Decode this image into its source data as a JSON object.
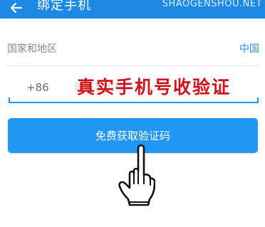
{
  "header": {
    "back_icon": "arrow-left-icon",
    "title": "绑定手机",
    "watermark": "SHAOGENSHOU.NET"
  },
  "region_row": {
    "label": "国家和地区",
    "value": "中国"
  },
  "phone_row": {
    "prefix": "+86",
    "placeholder": "填写手机号"
  },
  "overlay": {
    "caption": "真实手机号收验证"
  },
  "primary_button": {
    "label": "免费获取验证码"
  },
  "colors": {
    "accent": "#2196f3",
    "header_bg": "#1e88e5",
    "caption_red": "#d0121b",
    "link_blue": "#2a91d8"
  },
  "icons": {
    "pointer": "hand-pointer-icon"
  }
}
